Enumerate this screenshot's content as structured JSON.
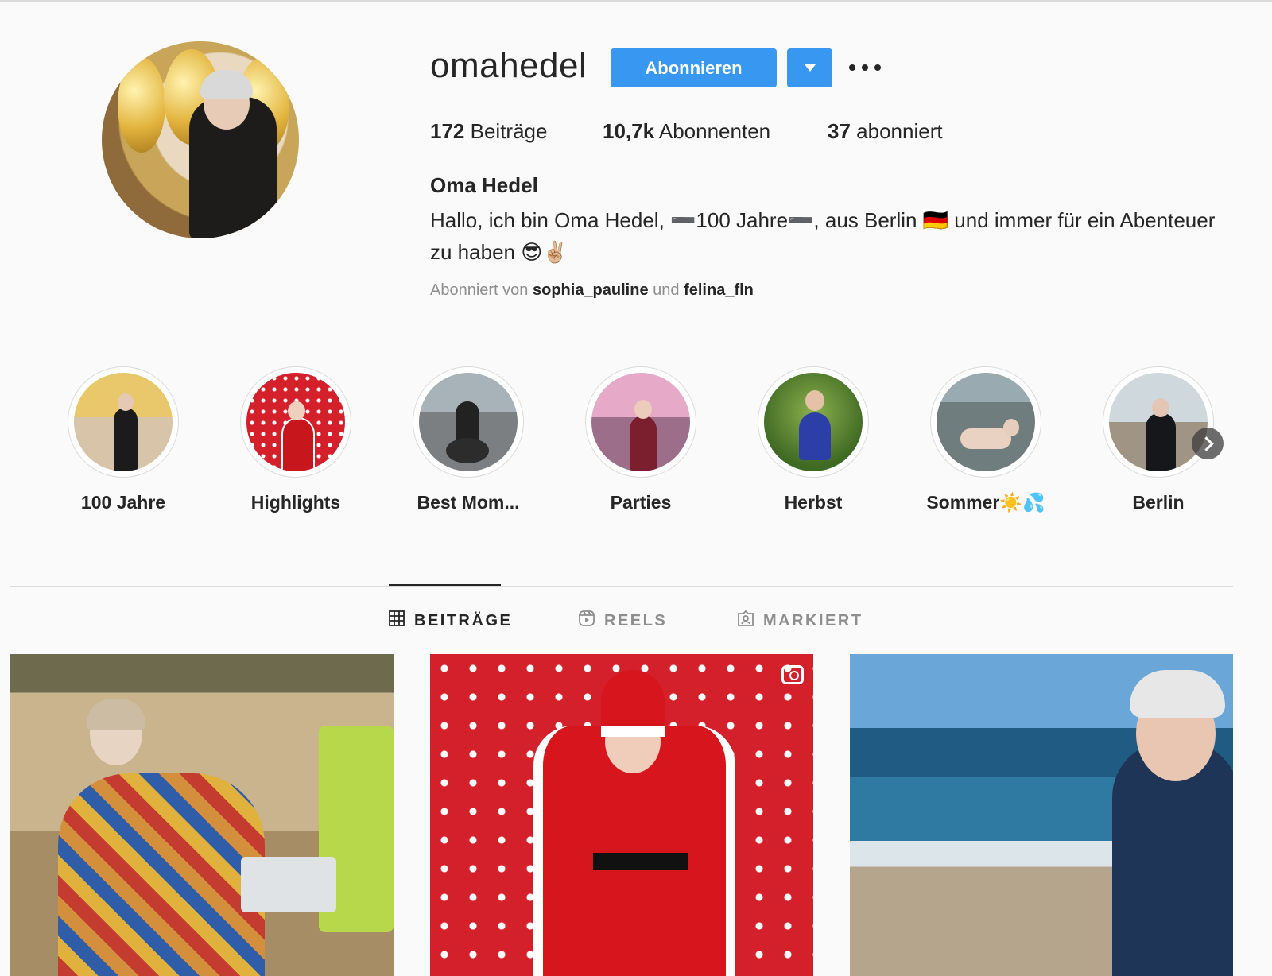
{
  "profile": {
    "username": "omahedel",
    "follow_label": "Abonnieren",
    "full_name": "Oma Hedel",
    "bio": "Hallo, ich bin Oma Hedel, ➖100 Jahre➖, aus Berlin 🇩🇪 und immer für ein Abenteuer zu haben 😎✌🏼",
    "followed_by_prefix": "Abonniert von",
    "followed_by_user1": "sophia_pauline",
    "followed_by_join": "und",
    "followed_by_user2": "felina_fln"
  },
  "stats": {
    "posts_count": "172",
    "posts_label": "Beiträge",
    "followers_count": "10,7k",
    "followers_label": "Abonnenten",
    "following_count": "37",
    "following_label": "abonniert"
  },
  "highlights": [
    {
      "label": "100 Jahre"
    },
    {
      "label": "Highlights"
    },
    {
      "label": "Best Mom..."
    },
    {
      "label": "Parties"
    },
    {
      "label": "Herbst"
    },
    {
      "label": "Sommer☀️💦"
    },
    {
      "label": "Berlin"
    }
  ],
  "tabs": [
    {
      "label": "BEITRÄGE",
      "icon": "grid-icon",
      "active": true
    },
    {
      "label": "REELS",
      "icon": "reels-icon",
      "active": false
    },
    {
      "label": "MARKIERT",
      "icon": "tagged-icon",
      "active": false
    }
  ],
  "colors": {
    "accent": "#3897f0",
    "text": "#262626",
    "secondary_text": "#8e8e8e",
    "background": "#fafafa",
    "divider": "#dbdbdb"
  }
}
